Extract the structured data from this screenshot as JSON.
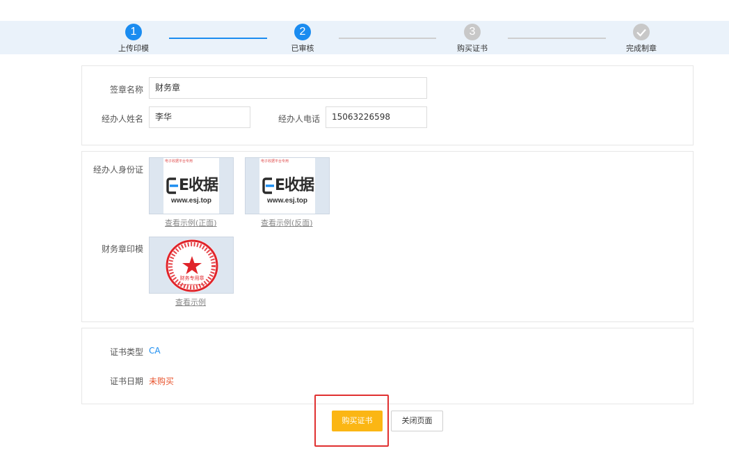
{
  "steps": [
    {
      "num": "1",
      "label": "上传印模",
      "state": "active"
    },
    {
      "num": "2",
      "label": "已审核",
      "state": "active"
    },
    {
      "num": "3",
      "label": "购买证书",
      "state": "inactive"
    },
    {
      "num": "",
      "label": "完成制章",
      "state": "inactive"
    }
  ],
  "form": {
    "seal_name_label": "签章名称",
    "seal_name_value": "财务章",
    "agent_name_label": "经办人姓名",
    "agent_name_value": "李华",
    "agent_phone_label": "经办人电话",
    "agent_phone_value": "15063226598"
  },
  "uploads": {
    "id_card_label": "经办人身份证",
    "id_front_link": "查看示例(正面)",
    "id_back_link": "查看示例(反面)",
    "logo_text": "E收据",
    "logo_url": "www.esj.top",
    "seal_label": "财务章印模",
    "seal_link": "查看示例",
    "seal_text": "财务专用章"
  },
  "cert": {
    "type_label": "证书类型",
    "type_value": "CA",
    "date_label": "证书日期",
    "date_value": "未购买"
  },
  "actions": {
    "buy_label": "购买证书",
    "close_label": "关闭页面"
  },
  "colors": {
    "accent": "#1a8cf0",
    "buy_button": "#fbb614",
    "not_purchased": "#e8542e",
    "highlight": "#e03030"
  }
}
